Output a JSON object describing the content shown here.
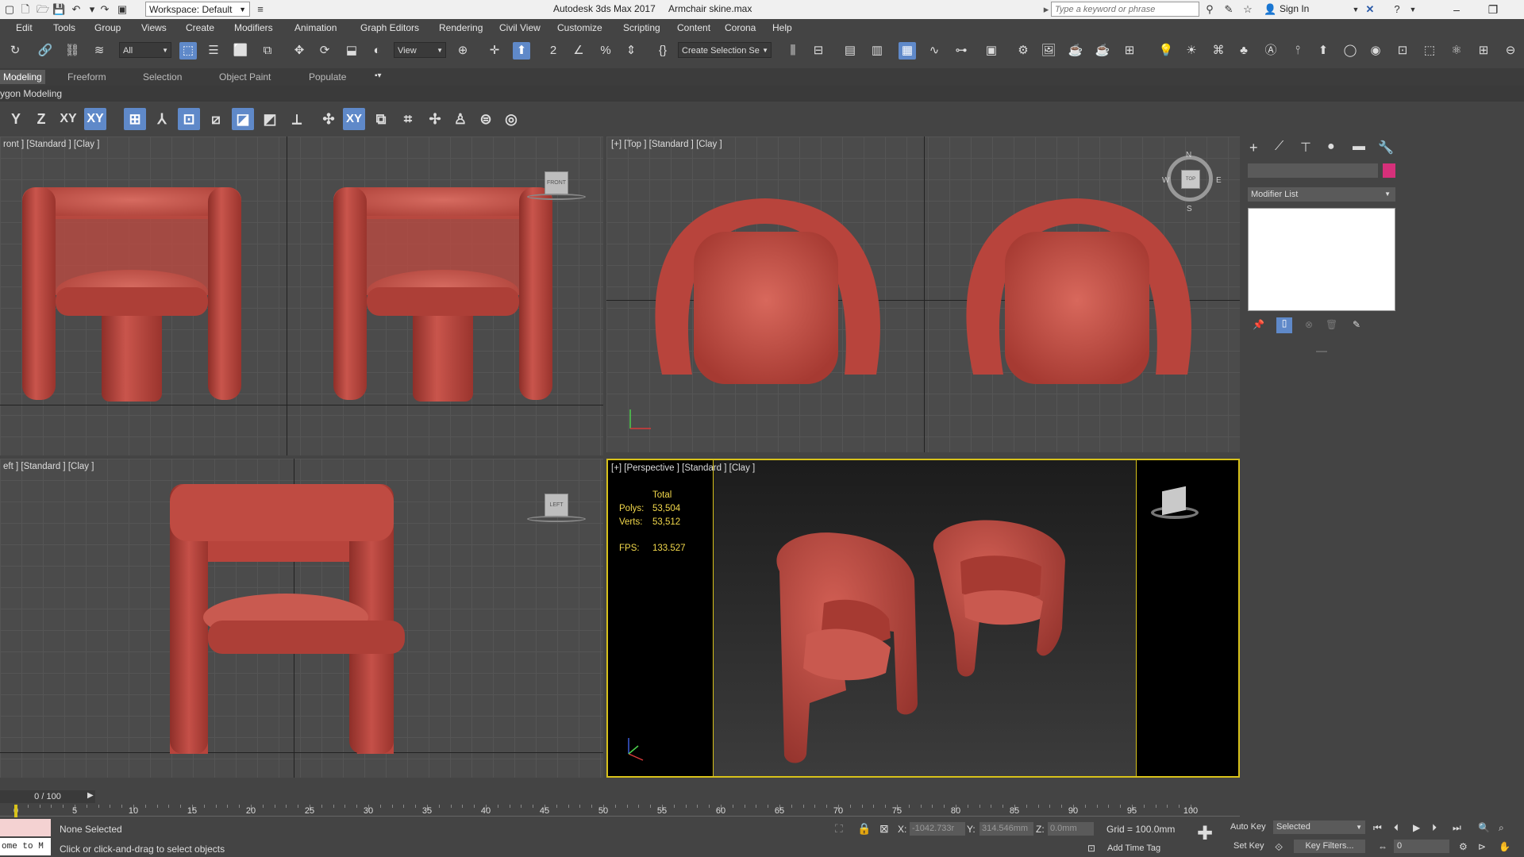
{
  "titlebar": {
    "workspace": "Workspace: Default",
    "app_title": "Autodesk 3ds Max 2017",
    "file_title": "Armchair skine.max",
    "search_placeholder": "Type a keyword or phrase",
    "sign_in": "Sign In"
  },
  "menu": [
    "Edit",
    "Tools",
    "Group",
    "Views",
    "Create",
    "Modifiers",
    "Animation",
    "Graph Editors",
    "Rendering",
    "Civil View",
    "Customize",
    "Scripting",
    "Content",
    "Corona",
    "Help"
  ],
  "toolbar": {
    "filter": "All",
    "ref_coord": "View",
    "selection_set": "Create Selection Se"
  },
  "ribbon_tabs": [
    "Modeling",
    "Freeform",
    "Selection",
    "Object Paint",
    "Populate"
  ],
  "poly_modeling": "ygon Modeling",
  "constraints": [
    "Y",
    "Z",
    "XY",
    "XY"
  ],
  "viewports": {
    "front": "ront ] [Standard ] [Clay ]",
    "top": "[+] [Top ] [Standard ] [Clay ]",
    "left": "eft ] [Standard ] [Clay ]",
    "perspective": "[+] [Perspective ] [Standard ] [Clay ]"
  },
  "viewcube": {
    "front": "FRONT",
    "top": "TOP",
    "left": "LEFT",
    "compass": {
      "n": "N",
      "s": "S",
      "e": "E",
      "w": "W"
    }
  },
  "stats": {
    "header": "Total",
    "polys_label": "Polys:",
    "polys": "53,504",
    "verts_label": "Verts:",
    "verts": "53,512",
    "fps_label": "FPS:",
    "fps": "133.527"
  },
  "command_panel": {
    "modifier_list": "Modifier List",
    "object_color": "#d6307a"
  },
  "timeline": {
    "frame": "0 / 100",
    "ticks": [
      "0",
      "5",
      "10",
      "15",
      "20",
      "25",
      "30",
      "35",
      "40",
      "45",
      "50",
      "55",
      "60",
      "65",
      "70",
      "75",
      "80",
      "85",
      "90",
      "95",
      "100"
    ]
  },
  "status": {
    "maxscript": "ome to M",
    "selection": "None Selected",
    "prompt": "Click or click-and-drag to select objects",
    "x_label": "X:",
    "x": "-1042.733r",
    "y_label": "Y:",
    "y": "314.546mm",
    "z_label": "Z:",
    "z": "0.0mm",
    "grid": "Grid = 100.0mm",
    "add_time_tag": "Add Time Tag",
    "auto_key": "Auto Key",
    "set_key": "Set Key",
    "key_mode": "Selected",
    "key_filters": "Key Filters...",
    "current_frame": "0"
  },
  "colors": {
    "chair": "#b8443c",
    "active_viewport_border": "#d8c21a",
    "accent": "#5f89c9"
  }
}
